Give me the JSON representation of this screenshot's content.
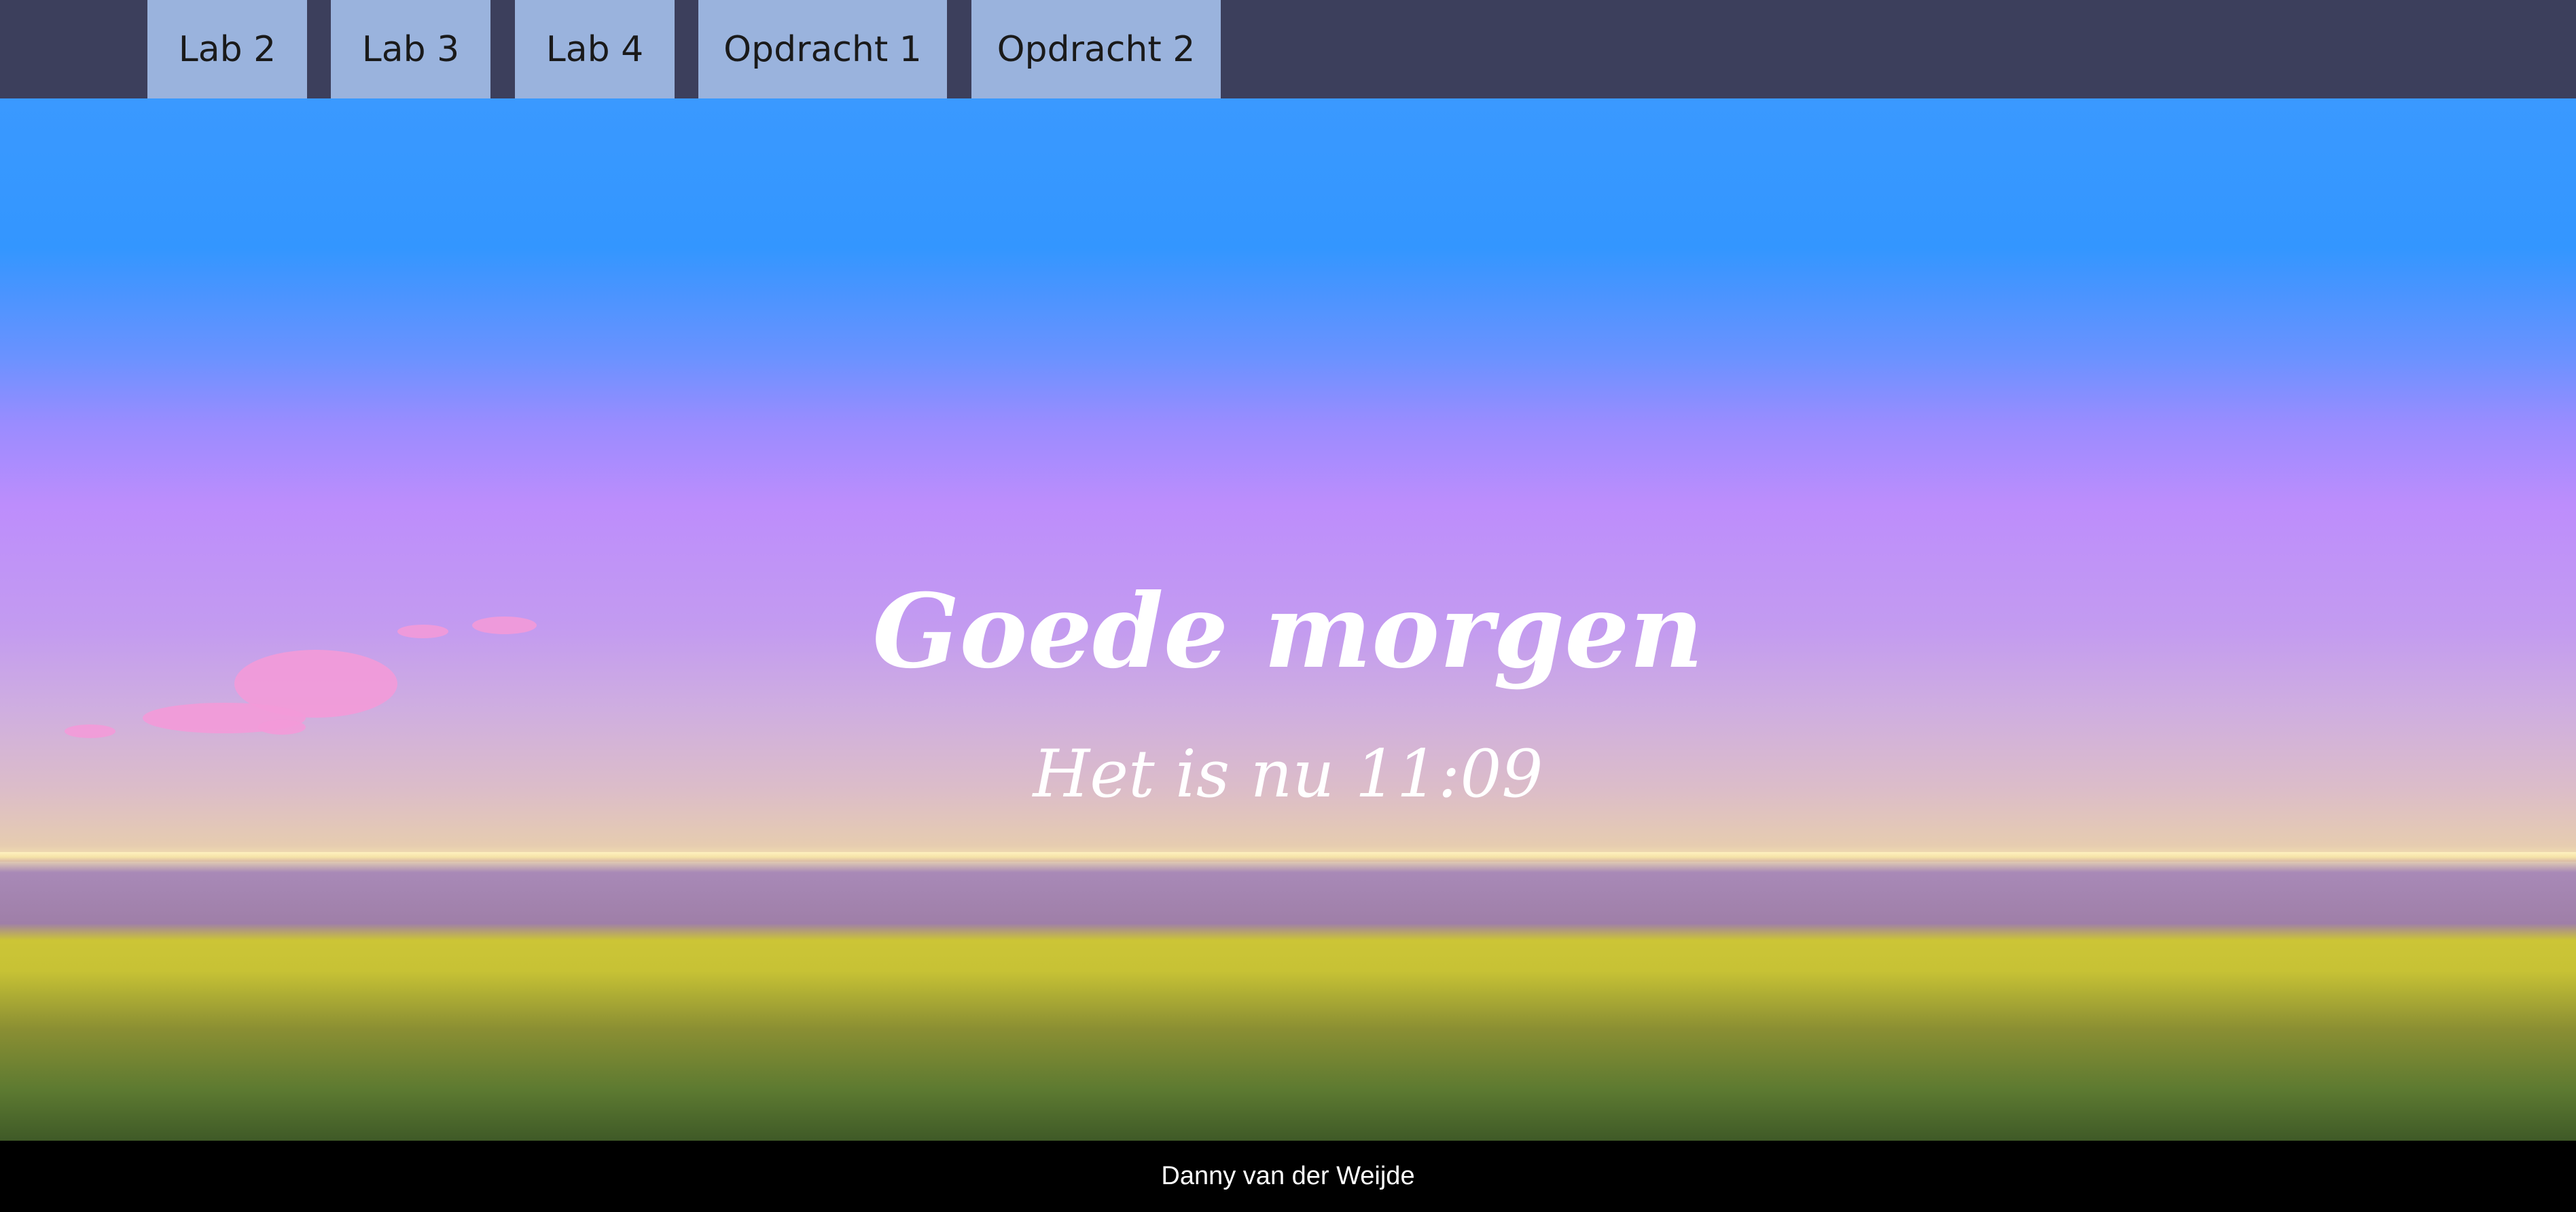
{
  "nav": {
    "items": [
      {
        "label": "Lab 2"
      },
      {
        "label": "Lab 3"
      },
      {
        "label": "Lab 4"
      },
      {
        "label": "Opdracht 1"
      },
      {
        "label": "Opdracht 2"
      }
    ]
  },
  "hero": {
    "greeting": "Goede morgen",
    "time_text": "Het is nu 11:09"
  },
  "footer": {
    "author": "Danny van der Weijde"
  },
  "colors": {
    "navbar": "#3c3f5c",
    "nav_item": "#9ab3dd",
    "footer": "#000000",
    "sky_top": "#3396ff",
    "sky_mid": "#bd8dfc",
    "grass": "#ccc536"
  }
}
